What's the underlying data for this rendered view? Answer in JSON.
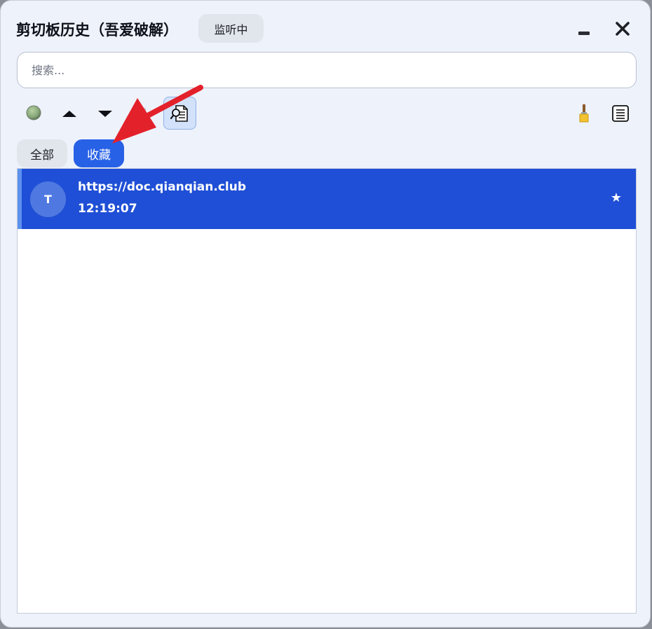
{
  "window": {
    "title": "剪切板历史（吾爱破解）",
    "status": "监听中",
    "controls": {
      "minimize_icon": "minimize-icon",
      "close_icon": "close-icon"
    }
  },
  "search": {
    "placeholder": "搜索...",
    "value": ""
  },
  "toolbar": {
    "items": [
      {
        "icon": "status-dot-icon",
        "color": "#8cad7c"
      },
      {
        "icon": "move-up-icon"
      },
      {
        "icon": "move-down-icon"
      },
      {
        "icon": "pin-icon"
      },
      {
        "icon": "document-search-icon",
        "active": true
      },
      {
        "icon": "brush-icon"
      },
      {
        "icon": "list-icon"
      }
    ]
  },
  "tabs": [
    {
      "label": "全部",
      "selected": false
    },
    {
      "label": "收藏",
      "selected": true
    }
  ],
  "items": [
    {
      "avatar": "T",
      "text": "https://doc.qianqian.club",
      "time": "12:19:07",
      "star": "★",
      "selected": true
    }
  ],
  "colors": {
    "accent": "#2761e6",
    "selected_row": "#1f4fd6",
    "annotation_arrow": "#e3212b"
  }
}
